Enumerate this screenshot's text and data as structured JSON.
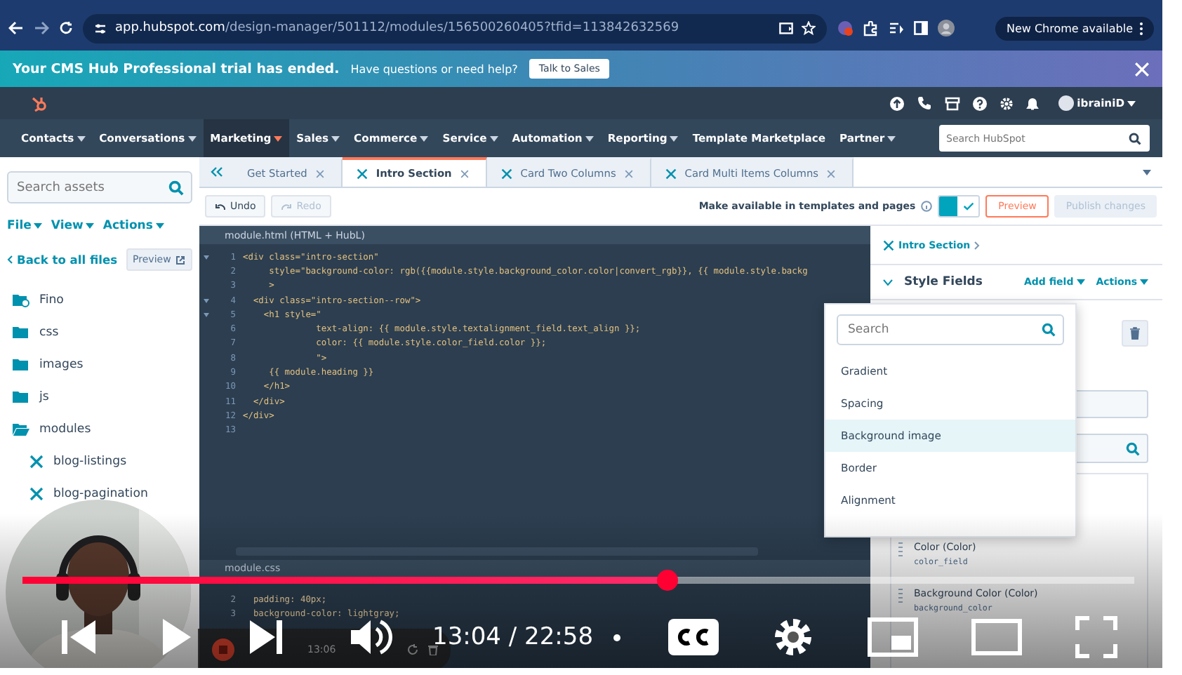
{
  "browser": {
    "url_host": "app.hubspot.com",
    "url_path": "/design-manager/501112/modules/156500260405?tfid=113842632569",
    "update_button": "New Chrome available"
  },
  "banner": {
    "title": "Your CMS Hub Professional trial has ended.",
    "message": "Have questions or need help?",
    "button": "Talk to Sales"
  },
  "hubspot_header": {
    "account": "ibrainiD"
  },
  "nav": {
    "items": [
      {
        "label": "Contacts",
        "selected": false,
        "menu": true
      },
      {
        "label": "Conversations",
        "selected": false,
        "menu": true
      },
      {
        "label": "Marketing",
        "selected": true,
        "menu": true
      },
      {
        "label": "Sales",
        "selected": false,
        "menu": true
      },
      {
        "label": "Commerce",
        "selected": false,
        "menu": true
      },
      {
        "label": "Service",
        "selected": false,
        "menu": true
      },
      {
        "label": "Automation",
        "selected": false,
        "menu": true
      },
      {
        "label": "Reporting",
        "selected": false,
        "menu": true
      },
      {
        "label": "Template Marketplace",
        "selected": false,
        "menu": false
      },
      {
        "label": "Partner",
        "selected": false,
        "menu": true
      }
    ],
    "search_placeholder": "Search HubSpot"
  },
  "sidebar": {
    "search_placeholder": "Search assets",
    "menus": [
      "File",
      "View",
      "Actions"
    ],
    "back_link": "Back to all files",
    "preview_button": "Preview",
    "tree": [
      {
        "label": "Fino",
        "kind": "theme",
        "expanded": false
      },
      {
        "label": "css",
        "kind": "folder",
        "expanded": false
      },
      {
        "label": "images",
        "kind": "folder",
        "expanded": false
      },
      {
        "label": "js",
        "kind": "folder",
        "expanded": false
      },
      {
        "label": "modules",
        "kind": "folder",
        "expanded": true,
        "children": [
          {
            "label": "blog-listings",
            "kind": "module"
          },
          {
            "label": "blog-pagination",
            "kind": "module"
          }
        ]
      }
    ]
  },
  "editor_tabs": [
    {
      "label": "Get Started",
      "kind": "page",
      "selected": false
    },
    {
      "label": "Intro Section",
      "kind": "module",
      "selected": true
    },
    {
      "label": "Card Two Columns",
      "kind": "module",
      "selected": false
    },
    {
      "label": "Card Multi Items Columns",
      "kind": "module",
      "selected": false
    }
  ],
  "toolbar": {
    "buttons": [
      {
        "label": "Undo",
        "disabled": false
      },
      {
        "label": "Redo",
        "disabled": true
      }
    ],
    "availability": {
      "label": "Make available in templates and pages",
      "on": true
    },
    "preview": "Preview",
    "publish": {
      "label": "Publish changes",
      "disabled": true
    }
  },
  "code_editor": {
    "file": "module.html (HTML + HubL)",
    "lines": [
      {
        "number": "1",
        "code": "<div class=\"intro-section\"",
        "foldable": true
      },
      {
        "number": "2",
        "code": "     style=\"background-color: rgb({{module.style.background_color.color|convert_rgb}}, {{ module.style.backg",
        "foldable": false
      },
      {
        "number": "3",
        "code": "     >",
        "foldable": false
      },
      {
        "number": "4",
        "code": "  <div class=\"intro-section--row\">",
        "foldable": true
      },
      {
        "number": "5",
        "code": "    <h1 style=\"",
        "foldable": true
      },
      {
        "number": "6",
        "code": "              text-align: {{ module.style.textalignment_field.text_align }};",
        "foldable": false
      },
      {
        "number": "7",
        "code": "              color: {{ module.style.color_field.color }};",
        "foldable": false
      },
      {
        "number": "8",
        "code": "              \">",
        "foldable": false
      },
      {
        "number": "9",
        "code": "     {{ module.heading }}",
        "foldable": false
      },
      {
        "number": "10",
        "code": "    </h1>",
        "foldable": false
      },
      {
        "number": "11",
        "code": "  </div>",
        "foldable": false
      },
      {
        "number": "12",
        "code": "</div>",
        "foldable": false
      },
      {
        "number": "13",
        "foldable": false
      }
    ]
  },
  "css_editor": {
    "file": "module.css",
    "lines": [
      {
        "number": "2",
        "code": "  padding: 40px;"
      },
      {
        "number": "3",
        "code": "  background-color: lightgray;"
      }
    ]
  },
  "fields_panel": {
    "breadcrumb": "Intro Section",
    "group": "Style Fields",
    "group_expanded": true,
    "add_field": "Add field",
    "actions": "Actions",
    "fields": [
      {
        "label": "Color (Color)",
        "name": "color_field"
      },
      {
        "label": "Background Color (Color)",
        "name": "background_color"
      }
    ]
  },
  "field_menu": {
    "search_placeholder": "Search",
    "options": [
      {
        "label": "Gradient",
        "selected": false
      },
      {
        "label": "Spacing",
        "selected": false
      },
      {
        "label": "Background image",
        "selected": true
      },
      {
        "label": "Border",
        "selected": false
      },
      {
        "label": "Alignment",
        "selected": false
      }
    ]
  },
  "player": {
    "level": 0.58,
    "time": "13:04 / 22:58"
  },
  "recorder": {
    "time": "13:06"
  }
}
